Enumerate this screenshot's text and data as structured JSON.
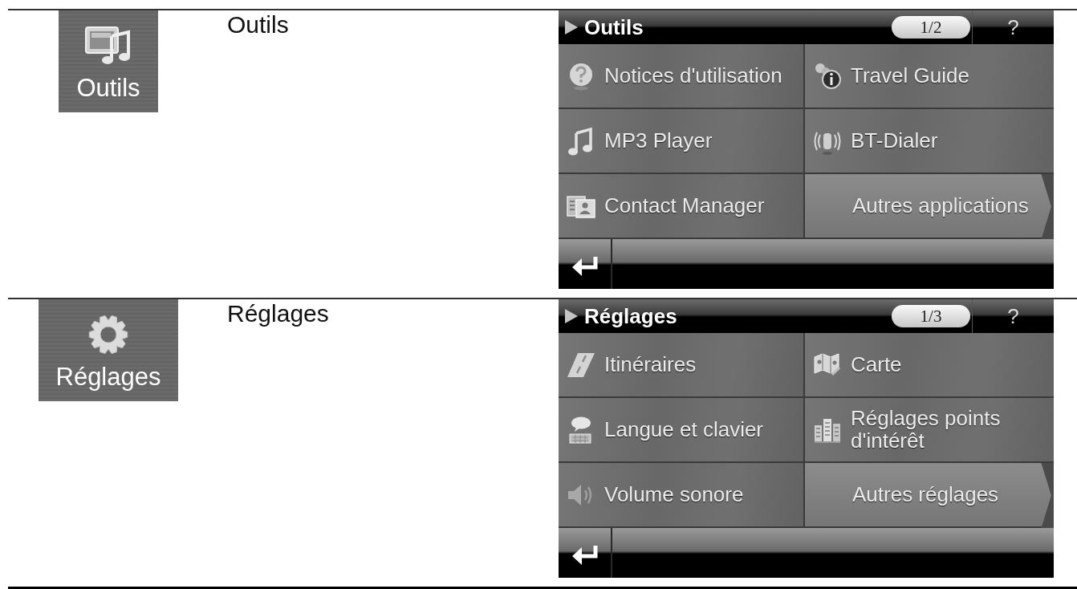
{
  "sections": [
    {
      "tile": {
        "label": "Outils"
      },
      "heading": "Outils",
      "screen": {
        "title": "Outils",
        "page": "1/2",
        "help": "?",
        "items": [
          {
            "kind": "option",
            "label": "Notices d'utilisation"
          },
          {
            "kind": "option",
            "label": "Travel Guide"
          },
          {
            "kind": "option",
            "label": "MP3 Player"
          },
          {
            "kind": "option",
            "label": "BT-Dialer"
          },
          {
            "kind": "option",
            "label": "Contact Manager"
          },
          {
            "kind": "more",
            "label": "Autres applications"
          }
        ]
      }
    },
    {
      "tile": {
        "label": "Réglages"
      },
      "heading": "Réglages",
      "screen": {
        "title": "Réglages",
        "page": "1/3",
        "help": "?",
        "items": [
          {
            "kind": "option",
            "label": "Itinéraires"
          },
          {
            "kind": "option",
            "label": "Carte"
          },
          {
            "kind": "option",
            "label": "Langue et clavier"
          },
          {
            "kind": "option",
            "label": "Réglages points d'intérêt"
          },
          {
            "kind": "option",
            "label": "Volume sonore"
          },
          {
            "kind": "more",
            "label": "Autres réglages"
          }
        ]
      }
    }
  ]
}
